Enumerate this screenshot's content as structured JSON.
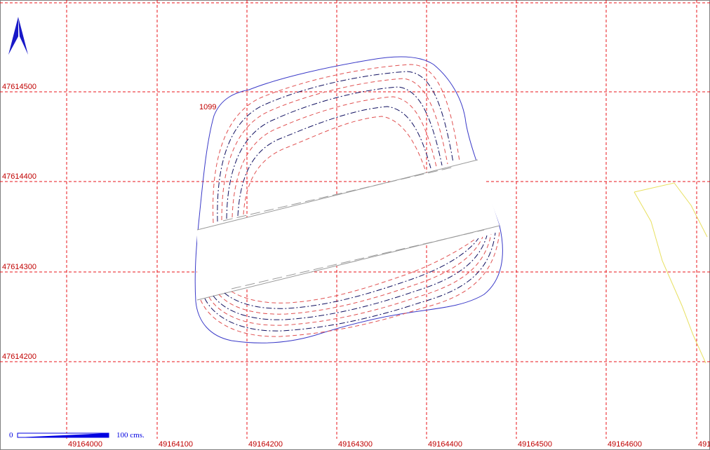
{
  "map": {
    "colors": {
      "grid": "#e8151b",
      "label": "#c00000",
      "outline": "#3a3ac8",
      "contour_red": "#e05050",
      "contour_blue": "#101060",
      "road": "#9a9a9a",
      "parcel": "#e8e060",
      "arrow": "#1818c8",
      "scalebar": "#0000e0"
    },
    "grid": {
      "x_labels": [
        "49164000",
        "49164100",
        "49164200",
        "49164300",
        "49164400",
        "49164500",
        "49164600",
        "491"
      ],
      "y_labels": [
        "47614500",
        "47614400",
        "47614300",
        "47614200"
      ]
    },
    "feature_label": "1099",
    "north_arrow": {
      "icon": "north-arrow-icon"
    },
    "scale_bar": {
      "min_label": "0",
      "max_label": "100 cms."
    }
  }
}
